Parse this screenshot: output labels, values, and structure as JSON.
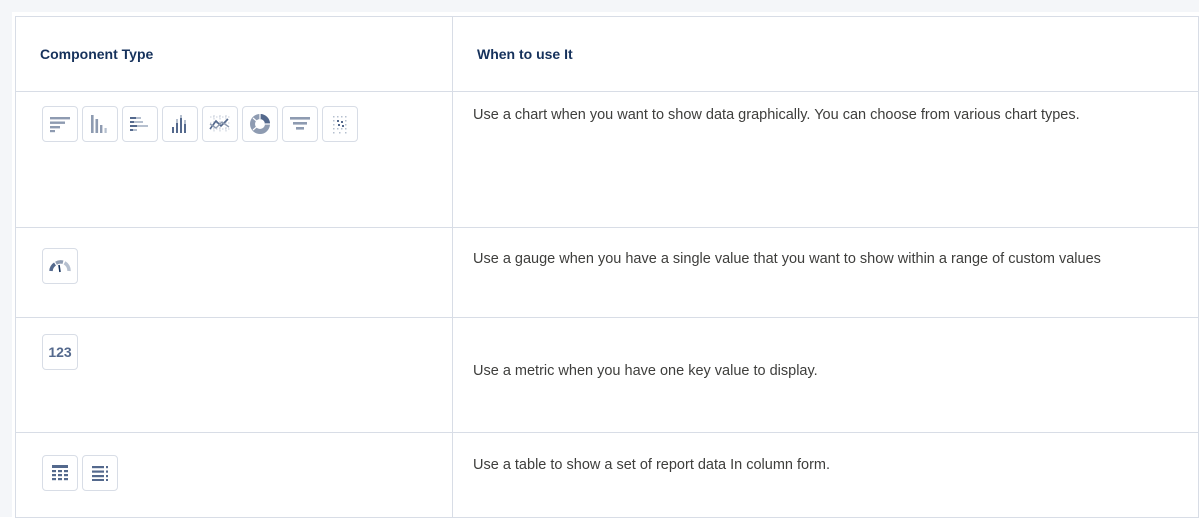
{
  "table": {
    "headers": [
      "Component Type",
      "When to use It"
    ],
    "rows": [
      {
        "icons": [
          "horizontal-bar-chart-icon",
          "vertical-bar-chart-icon",
          "stacked-horizontal-bar-chart-icon",
          "stacked-vertical-bar-chart-icon",
          "line-chart-icon",
          "donut-chart-icon",
          "funnel-chart-icon",
          "scatter-chart-icon"
        ],
        "description": "Use a chart when you want to show data graphically. You can choose from various chart types."
      },
      {
        "icons": [
          "gauge-icon"
        ],
        "description": "Use a gauge when you have a single value that you want to show within a range of custom values"
      },
      {
        "icons": [
          "metric-icon"
        ],
        "metric_label": "123",
        "description": "Use a metric when you have one key value to display."
      },
      {
        "icons": [
          "table-icon",
          "list-table-icon"
        ],
        "description": "Use a table to show a set of report data In column form."
      }
    ]
  },
  "colors": {
    "icon": "#8e9bb1",
    "icon_dark": "#54698d",
    "border": "#d8dde6",
    "text": "#3e3e3c",
    "header_text": "#16325c"
  }
}
